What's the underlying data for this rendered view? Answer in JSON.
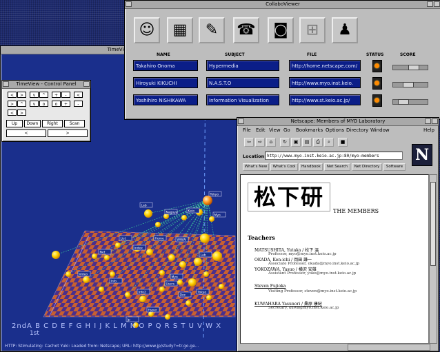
{
  "viewer": {
    "title": "TimeView",
    "status": "HTTP: Stimulating: Cachot Yuki: Loaded from: Netscape; URL: http://www.jp/study?=tr.go.ge..."
  },
  "control": {
    "title": "TimeView - Control Panel",
    "cells": [
      "<",
      ">",
      "v",
      "^",
      "+",
      "-",
      "<",
      ">",
      "^",
      "v",
      "o",
      "o",
      "+",
      "-",
      "<",
      ">"
    ],
    "buttons": [
      "Up",
      "Down",
      "Right",
      "Left",
      "Scan",
      "<",
      ">"
    ]
  },
  "collabo": {
    "title": "CollaboViewer",
    "icons": [
      "face-icon",
      "box-icon",
      "pen-icon",
      "phone-icon",
      "robot-icon",
      "puzzle-icon",
      "people-icon"
    ],
    "headers": {
      "name": "NAME",
      "subject": "SUBJECT",
      "file": "FILE",
      "status": "STATUS",
      "score": "SCORE"
    },
    "rows": [
      {
        "name": "Takahiro Onoma",
        "subject": "Hypermedia",
        "file": "http://home.netscape.com/",
        "score": 0.6
      },
      {
        "name": "Hiroyuki KIKUCHI",
        "subject": "N.A.S.T.O",
        "file": "http://www.myo.inst.keio.",
        "score": 0.4
      },
      {
        "name": "Yoshihiro NISHIKAWA",
        "subject": "Information Visualization",
        "file": "http://www.st.keio.ac.jp/",
        "score": 0.2
      }
    ],
    "status_color": "#ff8a00"
  },
  "netscape": {
    "title": "Netscape: Members of MYO Laboratory",
    "menu": [
      "File",
      "Edit",
      "View",
      "Go",
      "Bookmarks",
      "Options",
      "Directory",
      "Window",
      "Help"
    ],
    "location_label": "Location:",
    "location_value": "http://www.myo.inst.keio.ac.jp:80/myo-members",
    "nav_buttons": [
      "What's New",
      "What's Cool",
      "Handbook",
      "Net Search",
      "Net Directory",
      "Software"
    ],
    "page": {
      "banner": "松下研",
      "heading": "THE MEMBERS",
      "section": "Teachers",
      "entries": [
        {
          "name": "MATSUSHITA, Yutaka / 松下 温",
          "detail": "Professor, myo@myo.inst.keio.ac.jp"
        },
        {
          "name": "OKADA, Ken-ichi / 岡田 謙一",
          "detail": "Associate Professor, okada@myo.inst.keio.ac.jp"
        },
        {
          "name": "YOKOZAWA, Yasuo / 横沢 安雄",
          "detail": "Assistant Professor, yoko@myo.inst.keio.ac.jp"
        },
        {
          "name": "Steven Fujioka",
          "detail": "Visiting Professor, steven@myo.inst.keio.ac.jp"
        },
        {
          "name": "KUWAHARA Yasunori / 桑原 康紀",
          "detail": "Secretary, kuwa@myo.inst.keio.ac.jp"
        }
      ]
    }
  },
  "scene": {
    "axis_letters": "2ndA B C D E F G H I J K L M N O P Q R S T U V W X",
    "row_labels": [
      "2nd",
      "1st"
    ],
    "nodes_labels": [
      "Tokyo",
      "Myo",
      "Lab",
      "Nagoya",
      "Keio",
      "Home",
      "WWW",
      "Index",
      "List",
      "Net",
      "Video",
      "Info",
      "Info2",
      "Users",
      "Doc",
      "Hyper",
      "Jp"
    ]
  }
}
